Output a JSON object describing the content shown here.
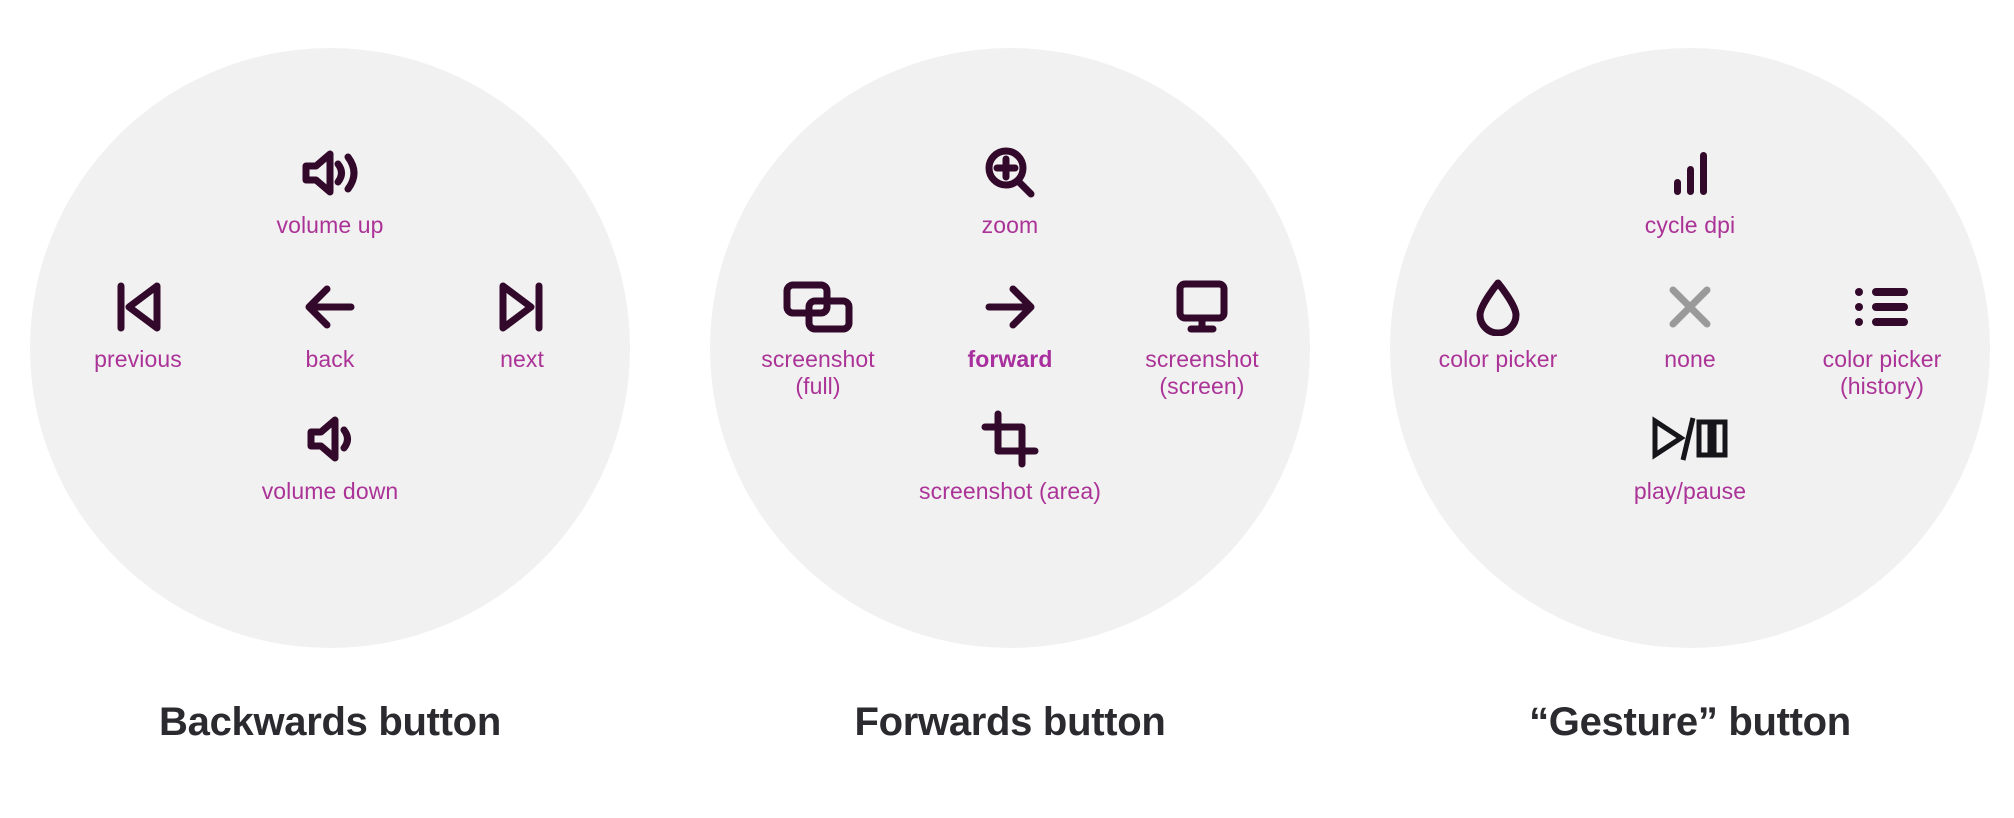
{
  "colors": {
    "disc_background": "#f2f1f1",
    "page_background": "#ffffff",
    "icon_ink": "#33092b",
    "label_magenta": "#ab3397",
    "muted_gray": "#9a9a9a",
    "near_black": "#15151a",
    "title_gray": "#2b2b2f"
  },
  "groups": [
    {
      "title": "Backwards button",
      "items": {
        "top": {
          "label": "volume up",
          "icon": "volume-up-icon"
        },
        "mid_left": {
          "label": "previous",
          "icon": "skip-previous-icon"
        },
        "mid_center": {
          "label": "back",
          "icon": "arrow-left-icon"
        },
        "mid_right": {
          "label": "next",
          "icon": "skip-next-icon"
        },
        "bottom": {
          "label": "volume down",
          "icon": "volume-down-icon"
        }
      }
    },
    {
      "title": "Forwards button",
      "items": {
        "top": {
          "label": "zoom",
          "icon": "magnifier-plus-icon"
        },
        "mid_left": {
          "label": "screenshot\n(full)",
          "icon": "windows-stack-icon"
        },
        "mid_center": {
          "label": "forward",
          "icon": "arrow-right-icon"
        },
        "mid_right": {
          "label": "screenshot\n(screen)",
          "icon": "monitor-icon"
        },
        "bottom": {
          "label": "screenshot (area)",
          "icon": "crop-icon"
        }
      }
    },
    {
      "title": "“Gesture” button",
      "items": {
        "top": {
          "label": "cycle dpi",
          "icon": "signal-bars-icon"
        },
        "mid_left": {
          "label": "color picker",
          "icon": "droplet-icon"
        },
        "mid_center": {
          "label": "none",
          "icon": "close-x-icon"
        },
        "mid_right": {
          "label": "color picker\n(history)",
          "icon": "list-bullets-icon"
        },
        "bottom": {
          "label": "play/pause",
          "icon": "play-pause-icon"
        }
      }
    }
  ]
}
